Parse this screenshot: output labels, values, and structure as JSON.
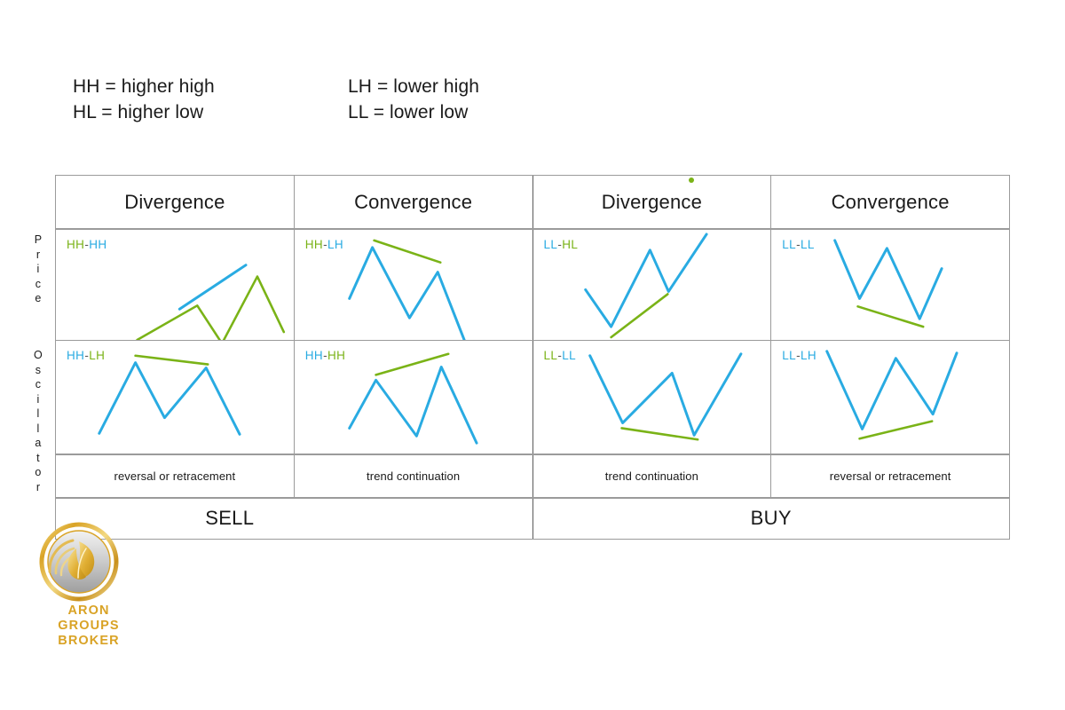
{
  "legend": {
    "rows": [
      {
        "left": "HH = higher high",
        "right": "LH = lower high"
      },
      {
        "left": "HL = higher low",
        "right": "LL = lower low"
      }
    ]
  },
  "side_labels": {
    "price": "Price",
    "oscillator": "Oscillator"
  },
  "colors": {
    "green": "#7ab317",
    "blue": "#29abe2",
    "border": "#9b9b9b",
    "divider": "#5a5a5a",
    "text": "#1a1a1a",
    "logo_gold": "#d9a326"
  },
  "table": {
    "headers": [
      "Divergence",
      "Convergence",
      "Divergence",
      "Convergence"
    ],
    "price_labels": [
      {
        "first": "HH",
        "first_color": "green",
        "sep": "-",
        "second": "HH",
        "second_color": "blue"
      },
      {
        "first": "HH",
        "first_color": "green",
        "sep": "-",
        "second": "LH",
        "second_color": "blue"
      },
      {
        "first": "LL",
        "first_color": "blue",
        "sep": "-",
        "second": "HL",
        "second_color": "green"
      },
      {
        "first": "LL",
        "first_color": "blue",
        "sep": "-",
        "second": "LL",
        "second_color": "blue"
      }
    ],
    "oscillator_labels": [
      {
        "first": "HH",
        "first_color": "blue",
        "sep": "-",
        "second": "LH",
        "second_color": "green"
      },
      {
        "first": "HH",
        "first_color": "blue",
        "sep": "-",
        "second": "HH",
        "second_color": "green"
      },
      {
        "first": "LL",
        "first_color": "green",
        "sep": "-",
        "second": "LL",
        "second_color": "blue"
      },
      {
        "first": "LL",
        "first_color": "blue",
        "sep": "-",
        "second": "LH",
        "second_color": "blue"
      }
    ],
    "outcomes": [
      "reversal or retracement",
      "trend continuation",
      "trend continuation",
      "reversal or retracement"
    ],
    "actions": [
      {
        "label": "SELL"
      },
      {
        "label": "BUY"
      }
    ]
  },
  "logo": {
    "line1": "ARON",
    "line2": "GROUPS",
    "line3": "BROKER"
  },
  "chart_data": {
    "type": "line",
    "title": "Divergence / Convergence matrix between Price and Oscillator",
    "legend": [
      "HH = higher high",
      "HL = higher low",
      "LH = lower high",
      "LL = lower low"
    ],
    "columns": [
      {
        "header": "Divergence",
        "price_pattern": "HH-HH",
        "oscillator_pattern": "HH-LH",
        "outcome": "reversal or retracement",
        "action": "SELL",
        "price_zigzag_color": "green",
        "price_trendline_color": "blue",
        "price_trendline_direction": "up",
        "oscillator_zigzag_color": "blue",
        "oscillator_trendline_color": "green",
        "oscillator_trendline_direction": "down"
      },
      {
        "header": "Convergence",
        "price_pattern": "HH-LH",
        "oscillator_pattern": "HH-HH",
        "outcome": "trend continuation",
        "action": "SELL",
        "price_zigzag_color": "blue",
        "price_trendline_color": "green",
        "price_trendline_direction": "down",
        "oscillator_zigzag_color": "blue",
        "oscillator_trendline_color": "green",
        "oscillator_trendline_direction": "up"
      },
      {
        "header": "Divergence",
        "price_pattern": "LL-HL",
        "oscillator_pattern": "LL-LL",
        "outcome": "trend continuation",
        "action": "BUY",
        "price_zigzag_color": "blue",
        "price_trendline_color": "green",
        "price_trendline_direction": "up",
        "oscillator_zigzag_color": "blue",
        "oscillator_trendline_color": "green",
        "oscillator_trendline_direction": "down"
      },
      {
        "header": "Convergence",
        "price_pattern": "LL-LL",
        "oscillator_pattern": "LL-LH",
        "outcome": "reversal or retracement",
        "action": "BUY",
        "price_zigzag_color": "blue",
        "price_trendline_color": "green",
        "price_trendline_direction": "down",
        "oscillator_zigzag_color": "blue",
        "oscillator_trendline_color": "green",
        "oscillator_trendline_direction": "up"
      }
    ],
    "row_labels": [
      "Price",
      "Oscillator"
    ]
  }
}
